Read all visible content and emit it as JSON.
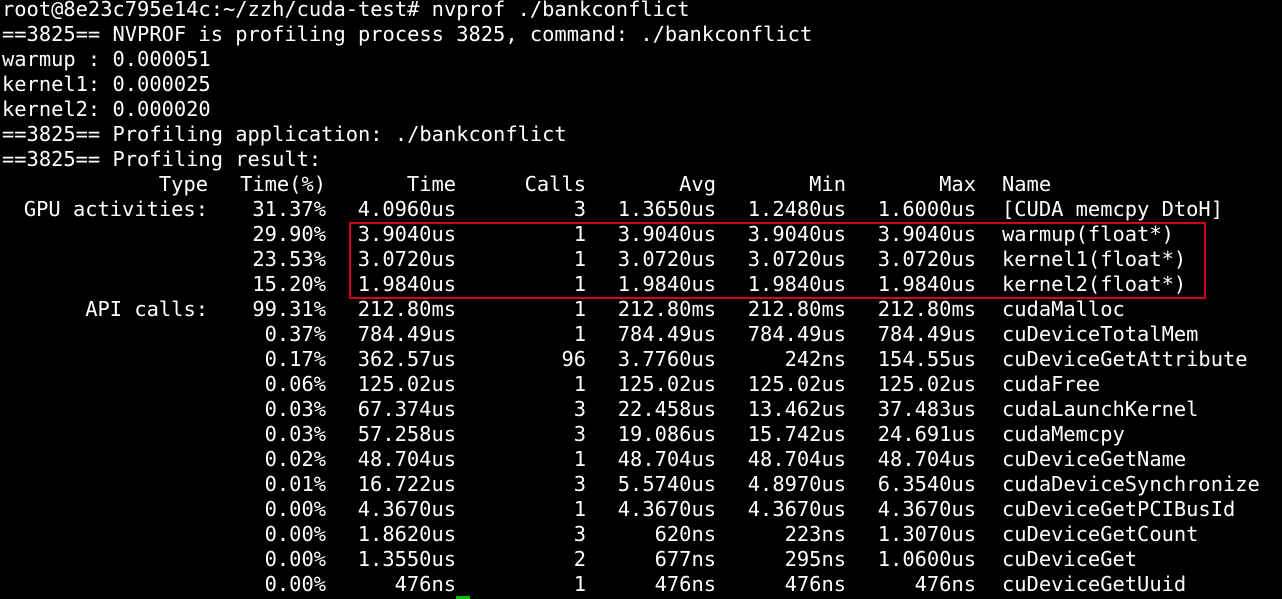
{
  "prompt_line": "root@8e23c795e14c:~/zzh/cuda-test# nvprof ./bankconflict",
  "output_lines": [
    "==3825== NVPROF is profiling process 3825, command: ./bankconflict",
    "warmup : 0.000051",
    "kernel1: 0.000025",
    "kernel2: 0.000020",
    "==3825== Profiling application: ./bankconflict",
    "==3825== Profiling result:"
  ],
  "table": {
    "headers": {
      "type": "Type",
      "pct": "Time(%)",
      "time": "Time",
      "calls": "Calls",
      "avg": "Avg",
      "min": "Min",
      "max": "Max",
      "name": "Name"
    },
    "rows": [
      {
        "type": "GPU activities:",
        "pct": "31.37%",
        "time": "4.0960us",
        "calls": "3",
        "avg": "1.3650us",
        "min": "1.2480us",
        "max": "1.6000us",
        "name": "[CUDA memcpy DtoH]"
      },
      {
        "type": "",
        "pct": "29.90%",
        "time": "3.9040us",
        "calls": "1",
        "avg": "3.9040us",
        "min": "3.9040us",
        "max": "3.9040us",
        "name": "warmup(float*)"
      },
      {
        "type": "",
        "pct": "23.53%",
        "time": "3.0720us",
        "calls": "1",
        "avg": "3.0720us",
        "min": "3.0720us",
        "max": "3.0720us",
        "name": "kernel1(float*)"
      },
      {
        "type": "",
        "pct": "15.20%",
        "time": "1.9840us",
        "calls": "1",
        "avg": "1.9840us",
        "min": "1.9840us",
        "max": "1.9840us",
        "name": "kernel2(float*)"
      },
      {
        "type": "API calls:",
        "pct": "99.31%",
        "time": "212.80ms",
        "calls": "1",
        "avg": "212.80ms",
        "min": "212.80ms",
        "max": "212.80ms",
        "name": "cudaMalloc"
      },
      {
        "type": "",
        "pct": "0.37%",
        "time": "784.49us",
        "calls": "1",
        "avg": "784.49us",
        "min": "784.49us",
        "max": "784.49us",
        "name": "cuDeviceTotalMem"
      },
      {
        "type": "",
        "pct": "0.17%",
        "time": "362.57us",
        "calls": "96",
        "avg": "3.7760us",
        "min": "242ns",
        "max": "154.55us",
        "name": "cuDeviceGetAttribute"
      },
      {
        "type": "",
        "pct": "0.06%",
        "time": "125.02us",
        "calls": "1",
        "avg": "125.02us",
        "min": "125.02us",
        "max": "125.02us",
        "name": "cudaFree"
      },
      {
        "type": "",
        "pct": "0.03%",
        "time": "67.374us",
        "calls": "3",
        "avg": "22.458us",
        "min": "13.462us",
        "max": "37.483us",
        "name": "cudaLaunchKernel"
      },
      {
        "type": "",
        "pct": "0.03%",
        "time": "57.258us",
        "calls": "3",
        "avg": "19.086us",
        "min": "15.742us",
        "max": "24.691us",
        "name": "cudaMemcpy"
      },
      {
        "type": "",
        "pct": "0.02%",
        "time": "48.704us",
        "calls": "1",
        "avg": "48.704us",
        "min": "48.704us",
        "max": "48.704us",
        "name": "cuDeviceGetName"
      },
      {
        "type": "",
        "pct": "0.01%",
        "time": "16.722us",
        "calls": "3",
        "avg": "5.5740us",
        "min": "4.8970us",
        "max": "6.3540us",
        "name": "cudaDeviceSynchronize"
      },
      {
        "type": "",
        "pct": "0.00%",
        "time": "4.3670us",
        "calls": "1",
        "avg": "4.3670us",
        "min": "4.3670us",
        "max": "4.3670us",
        "name": "cuDeviceGetPCIBusId"
      },
      {
        "type": "",
        "pct": "0.00%",
        "time": "1.8620us",
        "calls": "3",
        "avg": "620ns",
        "min": "223ns",
        "max": "1.3070us",
        "name": "cuDeviceGetCount"
      },
      {
        "type": "",
        "pct": "0.00%",
        "time": "1.3550us",
        "calls": "2",
        "avg": "677ns",
        "min": "295ns",
        "max": "1.0600us",
        "name": "cuDeviceGet"
      },
      {
        "type": "",
        "pct": "0.00%",
        "time": "476ns",
        "calls": "1",
        "avg": "476ns",
        "min": "476ns",
        "max": "476ns",
        "name": "cuDeviceGetUuid"
      }
    ]
  },
  "colors": {
    "background": "#000000",
    "text": "#ffffff",
    "highlight_box": "#d0021b",
    "cursor": "#00c000"
  }
}
